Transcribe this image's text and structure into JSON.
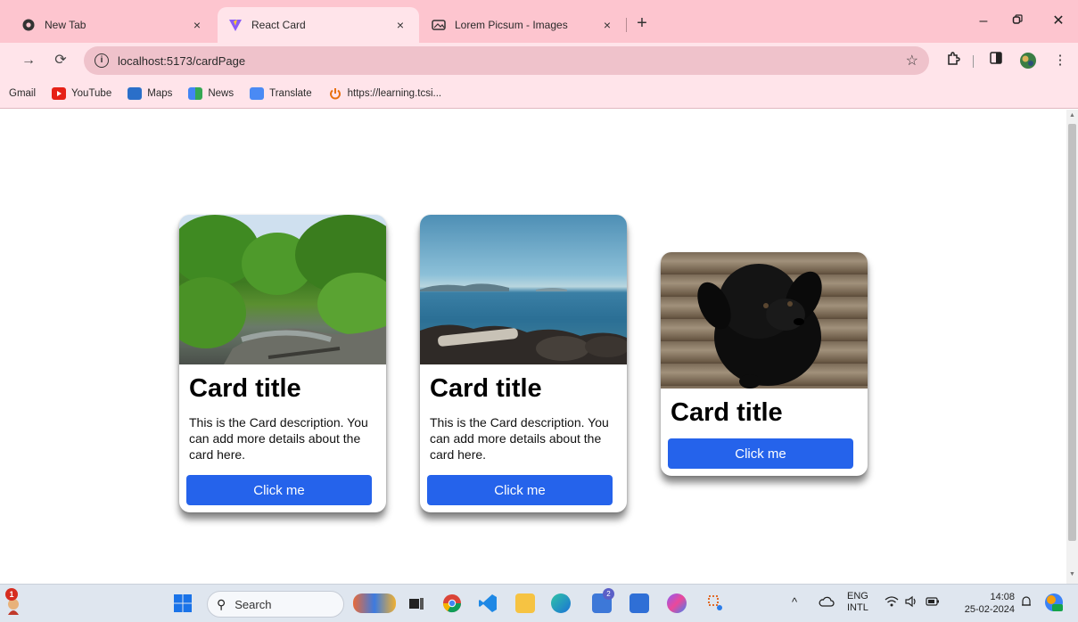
{
  "browser": {
    "tabs": [
      {
        "title": "New Tab",
        "active": false
      },
      {
        "title": "React Card",
        "active": true
      },
      {
        "title": "Lorem Picsum - Images",
        "active": false
      }
    ],
    "tab_close": "×",
    "new_tab": "+",
    "url": "localhost:5173/cardPage",
    "bookmarks": [
      "Gmail",
      "YouTube",
      "Maps",
      "News",
      "Translate",
      "https://learning.tcsi..."
    ]
  },
  "cards": [
    {
      "title": "Card title",
      "description": "This is the Card description. You can add more details about the card here.",
      "button": "Click me",
      "image": "forest-river"
    },
    {
      "title": "Card title",
      "description": "This is the Card description. You can add more details about the card here.",
      "button": "Click me",
      "image": "ocean-rocks"
    },
    {
      "title": "Card title",
      "button": "Click me",
      "image": "black-puppy-on-wood"
    }
  ],
  "taskbar": {
    "search_placeholder": "Search",
    "notification_count": "1",
    "teams_badge": "2",
    "lang_top": "ENG",
    "lang_bottom": "INTL",
    "time": "14:08",
    "date": "25-02-2024"
  },
  "colors": {
    "tab_strip": "#fdc5cf",
    "toolbar": "#ffe4ea",
    "button": "#2563eb"
  }
}
